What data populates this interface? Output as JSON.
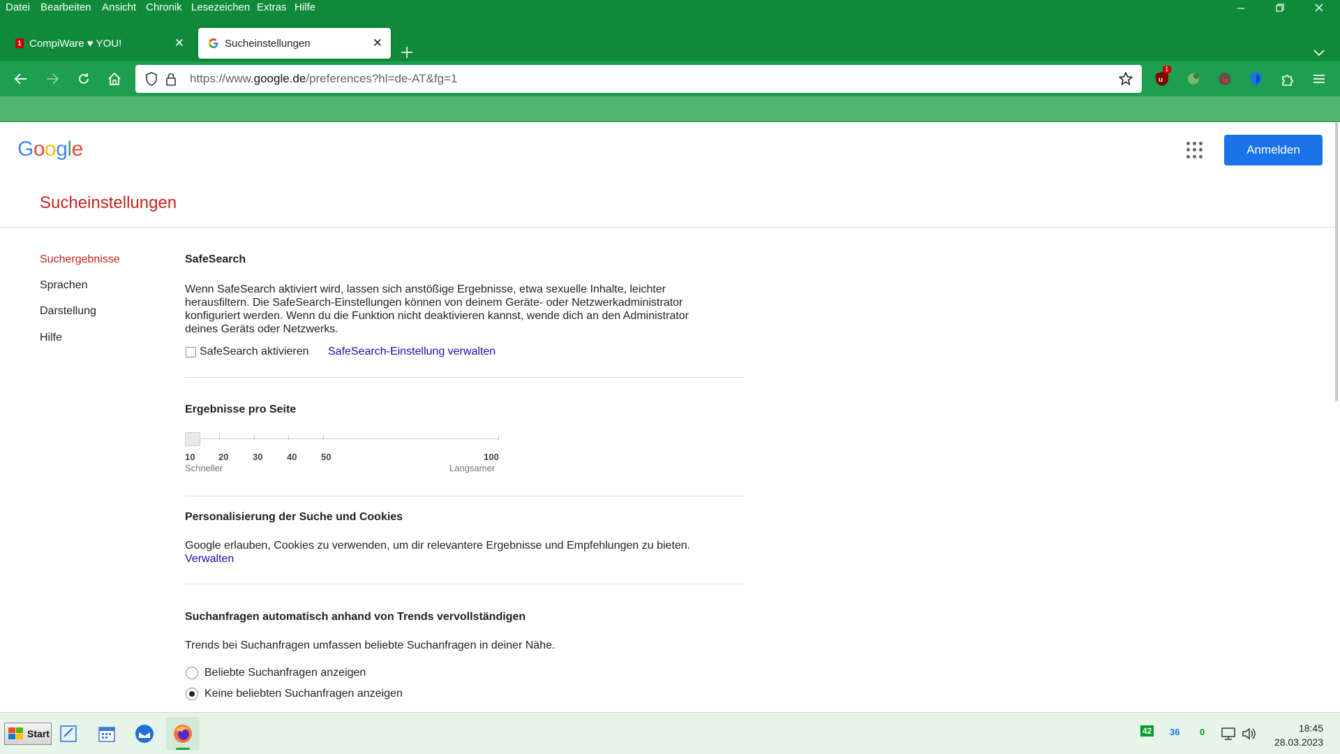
{
  "menu": [
    {
      "label": "Datei"
    },
    {
      "label": "Bearbeiten"
    },
    {
      "label": "Ansicht"
    },
    {
      "label": "Chronik"
    },
    {
      "label": "Lesezeichen"
    },
    {
      "label": "Extras"
    },
    {
      "label": "Hilfe"
    }
  ],
  "tabs": [
    {
      "title": "CompiWare ♥ YOU!",
      "badge": "1"
    },
    {
      "title": "Sucheinstellungen"
    }
  ],
  "url": {
    "prefix": "https://www.",
    "domain": "google.de",
    "path": "/preferences?hl=de-AT&fg=1"
  },
  "extensions": {
    "ublock_badge": "1"
  },
  "page": {
    "logo": "Google",
    "signin": "Anmelden",
    "title": "Sucheinstellungen",
    "nav": [
      "Suchergebnisse",
      "Sprachen",
      "Darstellung",
      "Hilfe"
    ],
    "safesearch": {
      "heading": "SafeSearch",
      "description_lines": [
        "Wenn SafeSearch aktiviert wird, lassen sich anstößige Ergebnisse, etwa sexuelle Inhalte, leichter",
        "herausfiltern. Die SafeSearch-Einstellungen können von deinem Geräte- oder Netzwerkadministrator",
        "konfiguriert werden. Wenn du die Funktion nicht deaktivieren kannst, wende dich an den Administrator",
        "deines Geräts oder Netzwerks."
      ],
      "checkbox_label": "SafeSearch aktivieren",
      "checked": false,
      "manage_link": "SafeSearch-Einstellung verwalten"
    },
    "results": {
      "heading": "Ergebnisse pro Seite",
      "ticks": [
        "10",
        "20",
        "30",
        "40",
        "50",
        "100"
      ],
      "selected": "10",
      "faster": "Schneller",
      "slower": "Langsamer"
    },
    "personalization": {
      "heading": "Personalisierung der Suche und Cookies",
      "text": "Google erlauben, Cookies zu verwenden, um dir relevantere Ergebnisse und Empfehlungen zu bieten.",
      "link": "Verwalten"
    },
    "trends": {
      "heading": "Suchanfragen automatisch anhand von Trends vervollständigen",
      "text": "Trends bei Suchanfragen umfassen beliebte Suchanfragen in deiner Nähe.",
      "options": [
        "Beliebte Suchanfragen anzeigen",
        "Keine beliebten Suchanfragen anzeigen"
      ],
      "selected_index": 1
    }
  },
  "taskbar": {
    "start": "Start",
    "tray": {
      "a": "42",
      "b": "36",
      "c": "0"
    },
    "time": "18:45",
    "date": "28.03.2023"
  },
  "colors": {
    "brand_green": "#0f8a3a",
    "accent_red": "#c5221f",
    "google_blue": "#1a73e8"
  }
}
